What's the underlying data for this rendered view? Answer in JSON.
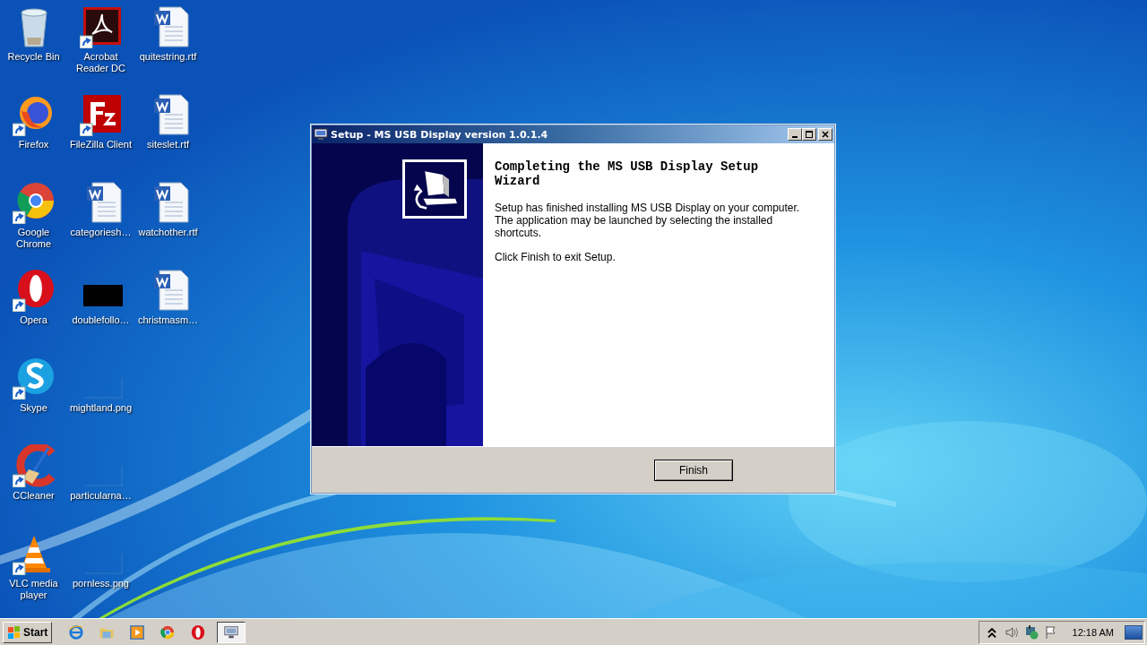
{
  "desktop_icons": [
    {
      "label": "Recycle Bin",
      "kind": "recycle",
      "shortcut": false
    },
    {
      "label": "Firefox",
      "kind": "firefox",
      "shortcut": true
    },
    {
      "label": "Google Chrome",
      "kind": "chrome",
      "shortcut": true
    },
    {
      "label": "Opera",
      "kind": "opera",
      "shortcut": true
    },
    {
      "label": "Skype",
      "kind": "skype",
      "shortcut": true
    },
    {
      "label": "CCleaner",
      "kind": "ccleaner",
      "shortcut": true
    },
    {
      "label": "VLC media player",
      "kind": "vlc",
      "shortcut": true
    },
    {
      "label": "Acrobat Reader DC",
      "kind": "acrobat",
      "shortcut": true
    },
    {
      "label": "FileZilla Client",
      "kind": "filezilla",
      "shortcut": true
    },
    {
      "label": "categoriesh…",
      "kind": "word",
      "shortcut": false
    },
    {
      "label": "doublefollo…",
      "kind": "black",
      "shortcut": false
    },
    {
      "label": "mightland.png",
      "kind": "blank",
      "shortcut": false
    },
    {
      "label": "particularna…",
      "kind": "blank",
      "shortcut": false
    },
    {
      "label": "pornless.png",
      "kind": "blank",
      "shortcut": false
    },
    {
      "label": "quitestring.rtf",
      "kind": "word",
      "shortcut": false
    },
    {
      "label": "siteslet.rtf",
      "kind": "word",
      "shortcut": false
    },
    {
      "label": "watchother.rtf",
      "kind": "word",
      "shortcut": false
    },
    {
      "label": "christmasm…",
      "kind": "word",
      "shortcut": false
    }
  ],
  "window": {
    "title": "Setup - MS USB Display version 1.0.1.4",
    "heading": "Completing the MS USB Display Setup Wizard",
    "paragraphs": [
      "Setup has finished installing MS USB Display on your computer. The application may be launched by selecting the installed shortcuts.",
      "Click Finish to exit Setup."
    ],
    "buttons": [
      "Finish"
    ]
  },
  "taskbar": {
    "start": "Start",
    "items": [
      {
        "kind": "ie",
        "selected": false
      },
      {
        "kind": "explorer",
        "selected": false
      },
      {
        "kind": "media",
        "selected": false
      },
      {
        "kind": "chrome",
        "selected": false
      },
      {
        "kind": "opera",
        "selected": false
      },
      {
        "kind": "setup",
        "selected": true
      }
    ],
    "clock": "12:18 AM"
  }
}
